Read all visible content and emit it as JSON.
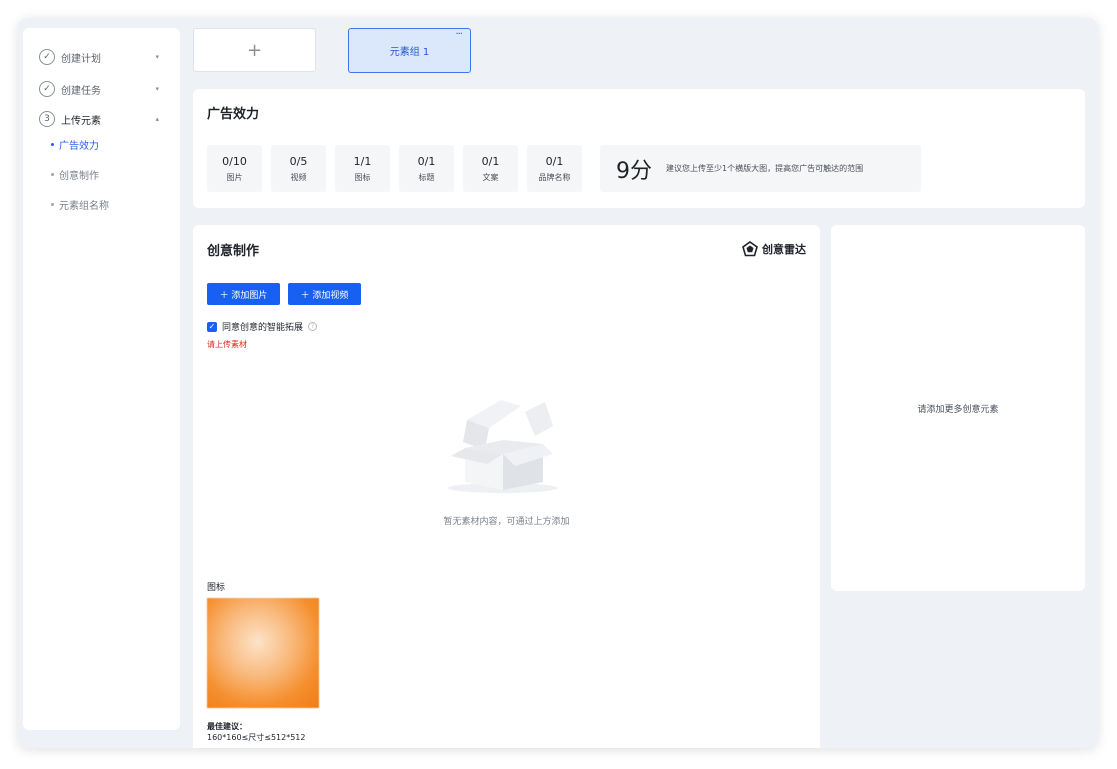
{
  "sidebar": {
    "steps": [
      {
        "label": "创建计划",
        "marker": "✓",
        "chevron": "▾"
      },
      {
        "label": "创建任务",
        "marker": "✓",
        "chevron": "▾"
      },
      {
        "label": "上传元素",
        "marker": "3",
        "chevron": "▴"
      }
    ],
    "subitems": [
      "广告效力",
      "创意制作",
      "元素组名称"
    ]
  },
  "tabs": {
    "add_symbol": "+",
    "group_label": "元素组 1",
    "more_symbol": "···"
  },
  "effect": {
    "title": "广告效力",
    "metrics": [
      {
        "value": "0/10",
        "label": "图片"
      },
      {
        "value": "0/5",
        "label": "视频"
      },
      {
        "value": "1/1",
        "label": "图标"
      },
      {
        "value": "0/1",
        "label": "标题"
      },
      {
        "value": "0/1",
        "label": "文案"
      },
      {
        "value": "0/1",
        "label": "品牌名称"
      }
    ],
    "score": "9分",
    "tip": "建议您上传至少1个横版大图，提高您广告可触达的范围"
  },
  "creative": {
    "title": "创意制作",
    "radar_label": "创意雷达",
    "add_image_label": "＋ 添加图片",
    "add_video_label": "＋ 添加视频",
    "agree_label": "同意创意的智能拓展",
    "check_mark": "✓",
    "help_mark": "?",
    "warning": "请上传素材",
    "empty_text": "暂无素材内容，可通过上方添加",
    "icon_label": "图标",
    "best_title": "最佳建议：",
    "best_size": "160*160≤尺寸≤512*512"
  },
  "right_panel": {
    "text": "请添加更多创意元素"
  },
  "colors": {
    "accent": "#1760f1",
    "tab_selected_bg": "#dbe7fb",
    "warning": "#e0261b",
    "page_bg": "#eef1f6"
  }
}
